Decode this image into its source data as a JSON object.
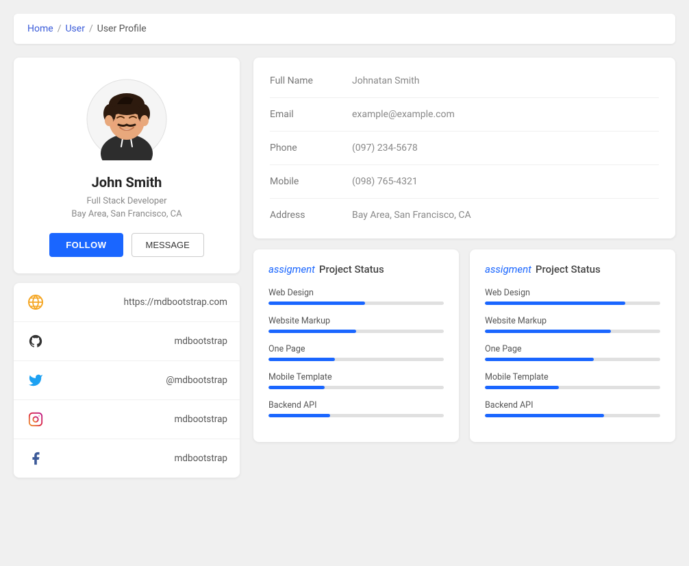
{
  "breadcrumb": {
    "home": "Home",
    "user": "User",
    "current": "User Profile"
  },
  "profile": {
    "name": "John Smith",
    "title": "Full Stack Developer",
    "location": "Bay Area, San Francisco, CA",
    "follow_label": "FOLLOW",
    "message_label": "MESSAGE"
  },
  "social": [
    {
      "id": "website",
      "icon": "globe-icon",
      "value": "https://mdbootstrap.com"
    },
    {
      "id": "github",
      "icon": "github-icon",
      "value": "mdbootstrap"
    },
    {
      "id": "twitter",
      "icon": "twitter-icon",
      "value": "@mdbootstrap"
    },
    {
      "id": "instagram",
      "icon": "instagram-icon",
      "value": "mdbootstrap"
    },
    {
      "id": "facebook",
      "icon": "facebook-icon",
      "value": "mdbootstrap"
    }
  ],
  "info": {
    "rows": [
      {
        "label": "Full Name",
        "value": "Johnatan Smith"
      },
      {
        "label": "Email",
        "value": "example@example.com"
      },
      {
        "label": "Phone",
        "value": "(097) 234-5678"
      },
      {
        "label": "Mobile",
        "value": "(098) 765-4321"
      },
      {
        "label": "Address",
        "value": "Bay Area, San Francisco, CA"
      }
    ]
  },
  "project_status_1": {
    "title_assignment": "assigment",
    "title_status": "Project Status",
    "items": [
      {
        "label": "Web Design",
        "percent": 55
      },
      {
        "label": "Website Markup",
        "percent": 50
      },
      {
        "label": "One Page",
        "percent": 38
      },
      {
        "label": "Mobile Template",
        "percent": 32
      },
      {
        "label": "Backend API",
        "percent": 35
      }
    ]
  },
  "project_status_2": {
    "title_assignment": "assigment",
    "title_status": "Project Status",
    "items": [
      {
        "label": "Web Design",
        "percent": 80
      },
      {
        "label": "Website Markup",
        "percent": 72
      },
      {
        "label": "One Page",
        "percent": 62
      },
      {
        "label": "Mobile Template",
        "percent": 42
      },
      {
        "label": "Backend API",
        "percent": 68
      }
    ]
  }
}
